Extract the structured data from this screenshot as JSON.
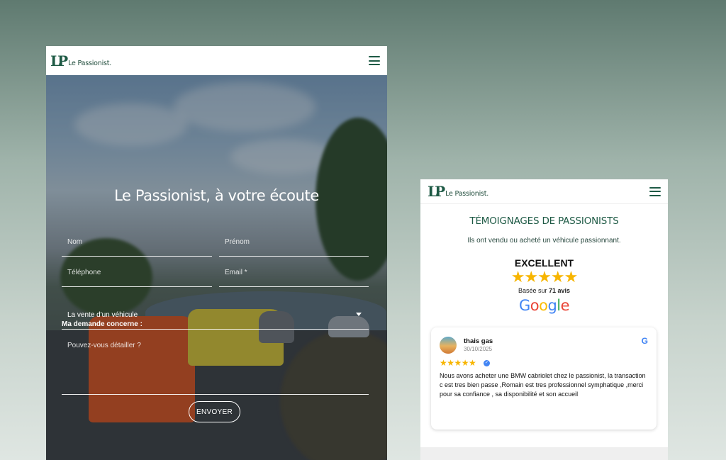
{
  "colors": {
    "brand": "#1e5a45",
    "star": "#f7b500",
    "background_top": "#5f7a70",
    "background_bottom": "#dfe6e2"
  },
  "left_screen": {
    "logo": {
      "mark": "LP",
      "text": "Le Passionist."
    },
    "menu_icon": "hamburger-menu-icon",
    "hero_title": "Le Passionist, à votre écoute",
    "form": {
      "nom_placeholder": "Nom",
      "prenom_placeholder": "Prénom",
      "telephone_placeholder": "Téléphone",
      "email_placeholder": "Email *",
      "demande_label": "Ma demande concerne :",
      "demande_selected": "La vente d'un véhicule",
      "details_placeholder": "Pouvez-vous détailler ?",
      "submit_label": "ENVOYER"
    }
  },
  "right_screen": {
    "logo": {
      "mark": "LP",
      "text": "Le Passionist."
    },
    "menu_icon": "hamburger-menu-icon",
    "section_title": "TÉMOIGNAGES DE PASSIONISTS",
    "section_subtitle": "Ils ont vendu ou acheté un véhicule passionnant.",
    "rating": {
      "label": "EXCELLENT",
      "stars": 5,
      "stars_text": "★★★★★",
      "based_prefix": "Basée sur",
      "count": "71 avis",
      "provider": "Google"
    },
    "review": {
      "name": "thais gas",
      "date": "30/10/2025",
      "stars": 5,
      "stars_text": "★★★★★",
      "verified_icon": "verified-check-icon",
      "google_icon": "G",
      "text": "Nous avons acheter une BMW cabriolet chez le passionist, la transaction c est tres bien passe ,Romain est tres professionnel symphatique ,merci pour sa confiance , sa disponibilité et son accueil"
    }
  }
}
